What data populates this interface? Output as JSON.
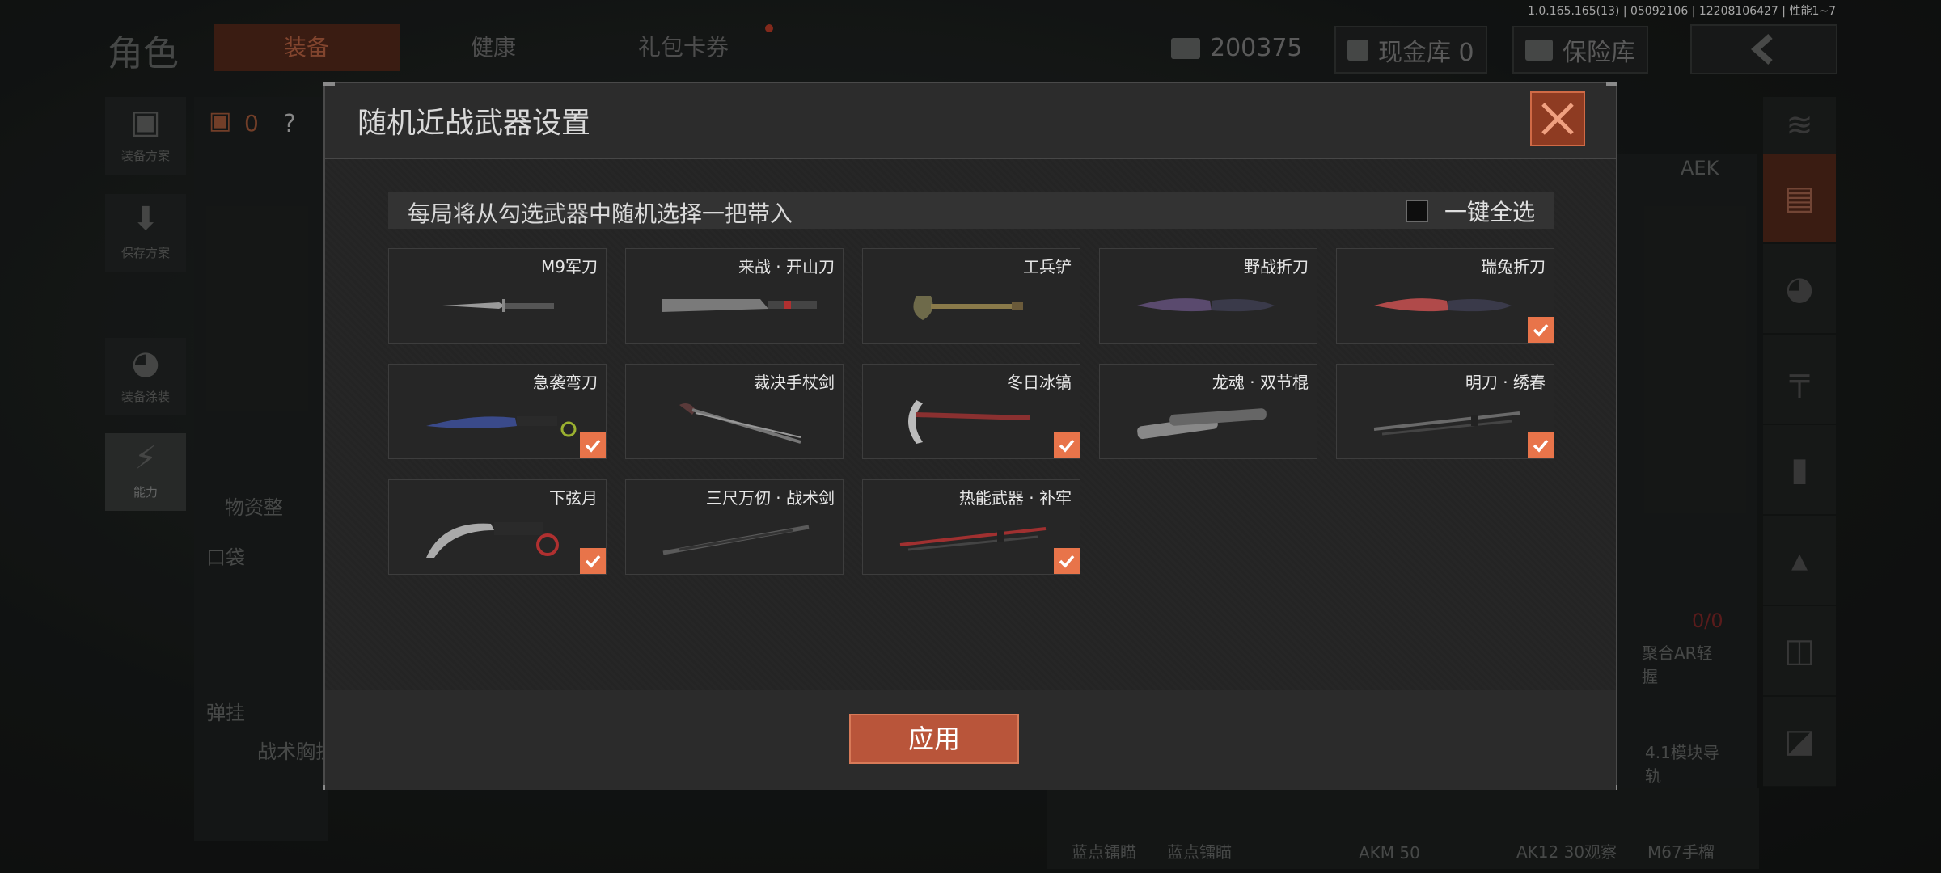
{
  "version": "1.0.165.165(13) | 05092106 | 12208106427 | 性能1~7",
  "header": {
    "title": "角色",
    "tabs": [
      {
        "label": "装备",
        "active": true
      },
      {
        "label": "健康",
        "active": false
      },
      {
        "label": "礼包卡券",
        "active": false
      }
    ],
    "currency_value": "200375",
    "cash_label": "现金库 0",
    "safe_label": "保险库"
  },
  "left_sidebar": {
    "items": [
      {
        "label": "装备方案",
        "icon": "backpack-icon"
      },
      {
        "label": "保存方案",
        "icon": "download-icon"
      },
      {
        "label": "装备涂装",
        "icon": "helmet-icon"
      },
      {
        "label": "能力",
        "icon": "lightning-icon"
      }
    ],
    "backpack_count": "0",
    "help": "?"
  },
  "background_texts": {
    "supply": "物资整",
    "pocket": "口袋",
    "ammo": "弹挂",
    "vest": "战术胸挂",
    "aek": "AEK",
    "ratio": "0/0",
    "stock": "聚合AR轻握",
    "rail": "4.1模块导轨",
    "bottom_labels": [
      "蓝点镭瞄",
      "蓝点镭瞄",
      "AKM 50",
      "AK12 30观察",
      "M67手榴"
    ]
  },
  "dialog": {
    "title": "随机近战武器设置",
    "info": "每局将从勾选武器中随机选择一把带入",
    "select_all_label": "一键全选",
    "select_all_checked": false,
    "apply_label": "应用",
    "weapons": [
      {
        "name": "M9军刀",
        "checked": false,
        "color": "#9a9a9a"
      },
      {
        "name": "来战 · 开山刀",
        "checked": false,
        "color": "#7a7a7a"
      },
      {
        "name": "工兵铲",
        "checked": false,
        "color": "#6e6a4a"
      },
      {
        "name": "野战折刀",
        "checked": false,
        "color": "#5a4a6e"
      },
      {
        "name": "瑞兔折刀",
        "checked": true,
        "color": "#b04a4a"
      },
      {
        "name": "急袭弯刀",
        "checked": true,
        "color": "#3a4a8a"
      },
      {
        "name": "裁决手杖剑",
        "checked": false,
        "color": "#777777"
      },
      {
        "name": "冬日冰镐",
        "checked": true,
        "color": "#8a3030"
      },
      {
        "name": "龙魂 · 双节棍",
        "checked": false,
        "color": "#888888"
      },
      {
        "name": "明刀 · 绣春",
        "checked": true,
        "color": "#6a6a6a"
      },
      {
        "name": "下弦月",
        "checked": true,
        "color": "#aaaaaa"
      },
      {
        "name": "三尺万仞 · 战术剑",
        "checked": false,
        "color": "#5a5a5a"
      },
      {
        "name": "热能武器 · 补牢",
        "checked": true,
        "color": "#a03030"
      }
    ]
  },
  "colors": {
    "accent": "#e8744a",
    "apply": "#b9553a"
  }
}
